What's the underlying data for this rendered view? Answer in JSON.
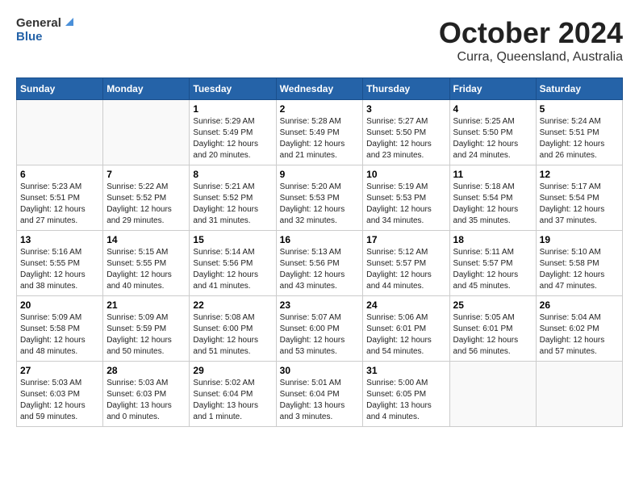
{
  "logo": {
    "general": "General",
    "blue": "Blue"
  },
  "title": "October 2024",
  "subtitle": "Curra, Queensland, Australia",
  "headers": [
    "Sunday",
    "Monday",
    "Tuesday",
    "Wednesday",
    "Thursday",
    "Friday",
    "Saturday"
  ],
  "weeks": [
    [
      {
        "day": "",
        "info": ""
      },
      {
        "day": "",
        "info": ""
      },
      {
        "day": "1",
        "info": "Sunrise: 5:29 AM\nSunset: 5:49 PM\nDaylight: 12 hours and 20 minutes."
      },
      {
        "day": "2",
        "info": "Sunrise: 5:28 AM\nSunset: 5:49 PM\nDaylight: 12 hours and 21 minutes."
      },
      {
        "day": "3",
        "info": "Sunrise: 5:27 AM\nSunset: 5:50 PM\nDaylight: 12 hours and 23 minutes."
      },
      {
        "day": "4",
        "info": "Sunrise: 5:25 AM\nSunset: 5:50 PM\nDaylight: 12 hours and 24 minutes."
      },
      {
        "day": "5",
        "info": "Sunrise: 5:24 AM\nSunset: 5:51 PM\nDaylight: 12 hours and 26 minutes."
      }
    ],
    [
      {
        "day": "6",
        "info": "Sunrise: 5:23 AM\nSunset: 5:51 PM\nDaylight: 12 hours and 27 minutes."
      },
      {
        "day": "7",
        "info": "Sunrise: 5:22 AM\nSunset: 5:52 PM\nDaylight: 12 hours and 29 minutes."
      },
      {
        "day": "8",
        "info": "Sunrise: 5:21 AM\nSunset: 5:52 PM\nDaylight: 12 hours and 31 minutes."
      },
      {
        "day": "9",
        "info": "Sunrise: 5:20 AM\nSunset: 5:53 PM\nDaylight: 12 hours and 32 minutes."
      },
      {
        "day": "10",
        "info": "Sunrise: 5:19 AM\nSunset: 5:53 PM\nDaylight: 12 hours and 34 minutes."
      },
      {
        "day": "11",
        "info": "Sunrise: 5:18 AM\nSunset: 5:54 PM\nDaylight: 12 hours and 35 minutes."
      },
      {
        "day": "12",
        "info": "Sunrise: 5:17 AM\nSunset: 5:54 PM\nDaylight: 12 hours and 37 minutes."
      }
    ],
    [
      {
        "day": "13",
        "info": "Sunrise: 5:16 AM\nSunset: 5:55 PM\nDaylight: 12 hours and 38 minutes."
      },
      {
        "day": "14",
        "info": "Sunrise: 5:15 AM\nSunset: 5:55 PM\nDaylight: 12 hours and 40 minutes."
      },
      {
        "day": "15",
        "info": "Sunrise: 5:14 AM\nSunset: 5:56 PM\nDaylight: 12 hours and 41 minutes."
      },
      {
        "day": "16",
        "info": "Sunrise: 5:13 AM\nSunset: 5:56 PM\nDaylight: 12 hours and 43 minutes."
      },
      {
        "day": "17",
        "info": "Sunrise: 5:12 AM\nSunset: 5:57 PM\nDaylight: 12 hours and 44 minutes."
      },
      {
        "day": "18",
        "info": "Sunrise: 5:11 AM\nSunset: 5:57 PM\nDaylight: 12 hours and 45 minutes."
      },
      {
        "day": "19",
        "info": "Sunrise: 5:10 AM\nSunset: 5:58 PM\nDaylight: 12 hours and 47 minutes."
      }
    ],
    [
      {
        "day": "20",
        "info": "Sunrise: 5:09 AM\nSunset: 5:58 PM\nDaylight: 12 hours and 48 minutes."
      },
      {
        "day": "21",
        "info": "Sunrise: 5:09 AM\nSunset: 5:59 PM\nDaylight: 12 hours and 50 minutes."
      },
      {
        "day": "22",
        "info": "Sunrise: 5:08 AM\nSunset: 6:00 PM\nDaylight: 12 hours and 51 minutes."
      },
      {
        "day": "23",
        "info": "Sunrise: 5:07 AM\nSunset: 6:00 PM\nDaylight: 12 hours and 53 minutes."
      },
      {
        "day": "24",
        "info": "Sunrise: 5:06 AM\nSunset: 6:01 PM\nDaylight: 12 hours and 54 minutes."
      },
      {
        "day": "25",
        "info": "Sunrise: 5:05 AM\nSunset: 6:01 PM\nDaylight: 12 hours and 56 minutes."
      },
      {
        "day": "26",
        "info": "Sunrise: 5:04 AM\nSunset: 6:02 PM\nDaylight: 12 hours and 57 minutes."
      }
    ],
    [
      {
        "day": "27",
        "info": "Sunrise: 5:03 AM\nSunset: 6:03 PM\nDaylight: 12 hours and 59 minutes."
      },
      {
        "day": "28",
        "info": "Sunrise: 5:03 AM\nSunset: 6:03 PM\nDaylight: 13 hours and 0 minutes."
      },
      {
        "day": "29",
        "info": "Sunrise: 5:02 AM\nSunset: 6:04 PM\nDaylight: 13 hours and 1 minute."
      },
      {
        "day": "30",
        "info": "Sunrise: 5:01 AM\nSunset: 6:04 PM\nDaylight: 13 hours and 3 minutes."
      },
      {
        "day": "31",
        "info": "Sunrise: 5:00 AM\nSunset: 6:05 PM\nDaylight: 13 hours and 4 minutes."
      },
      {
        "day": "",
        "info": ""
      },
      {
        "day": "",
        "info": ""
      }
    ]
  ]
}
